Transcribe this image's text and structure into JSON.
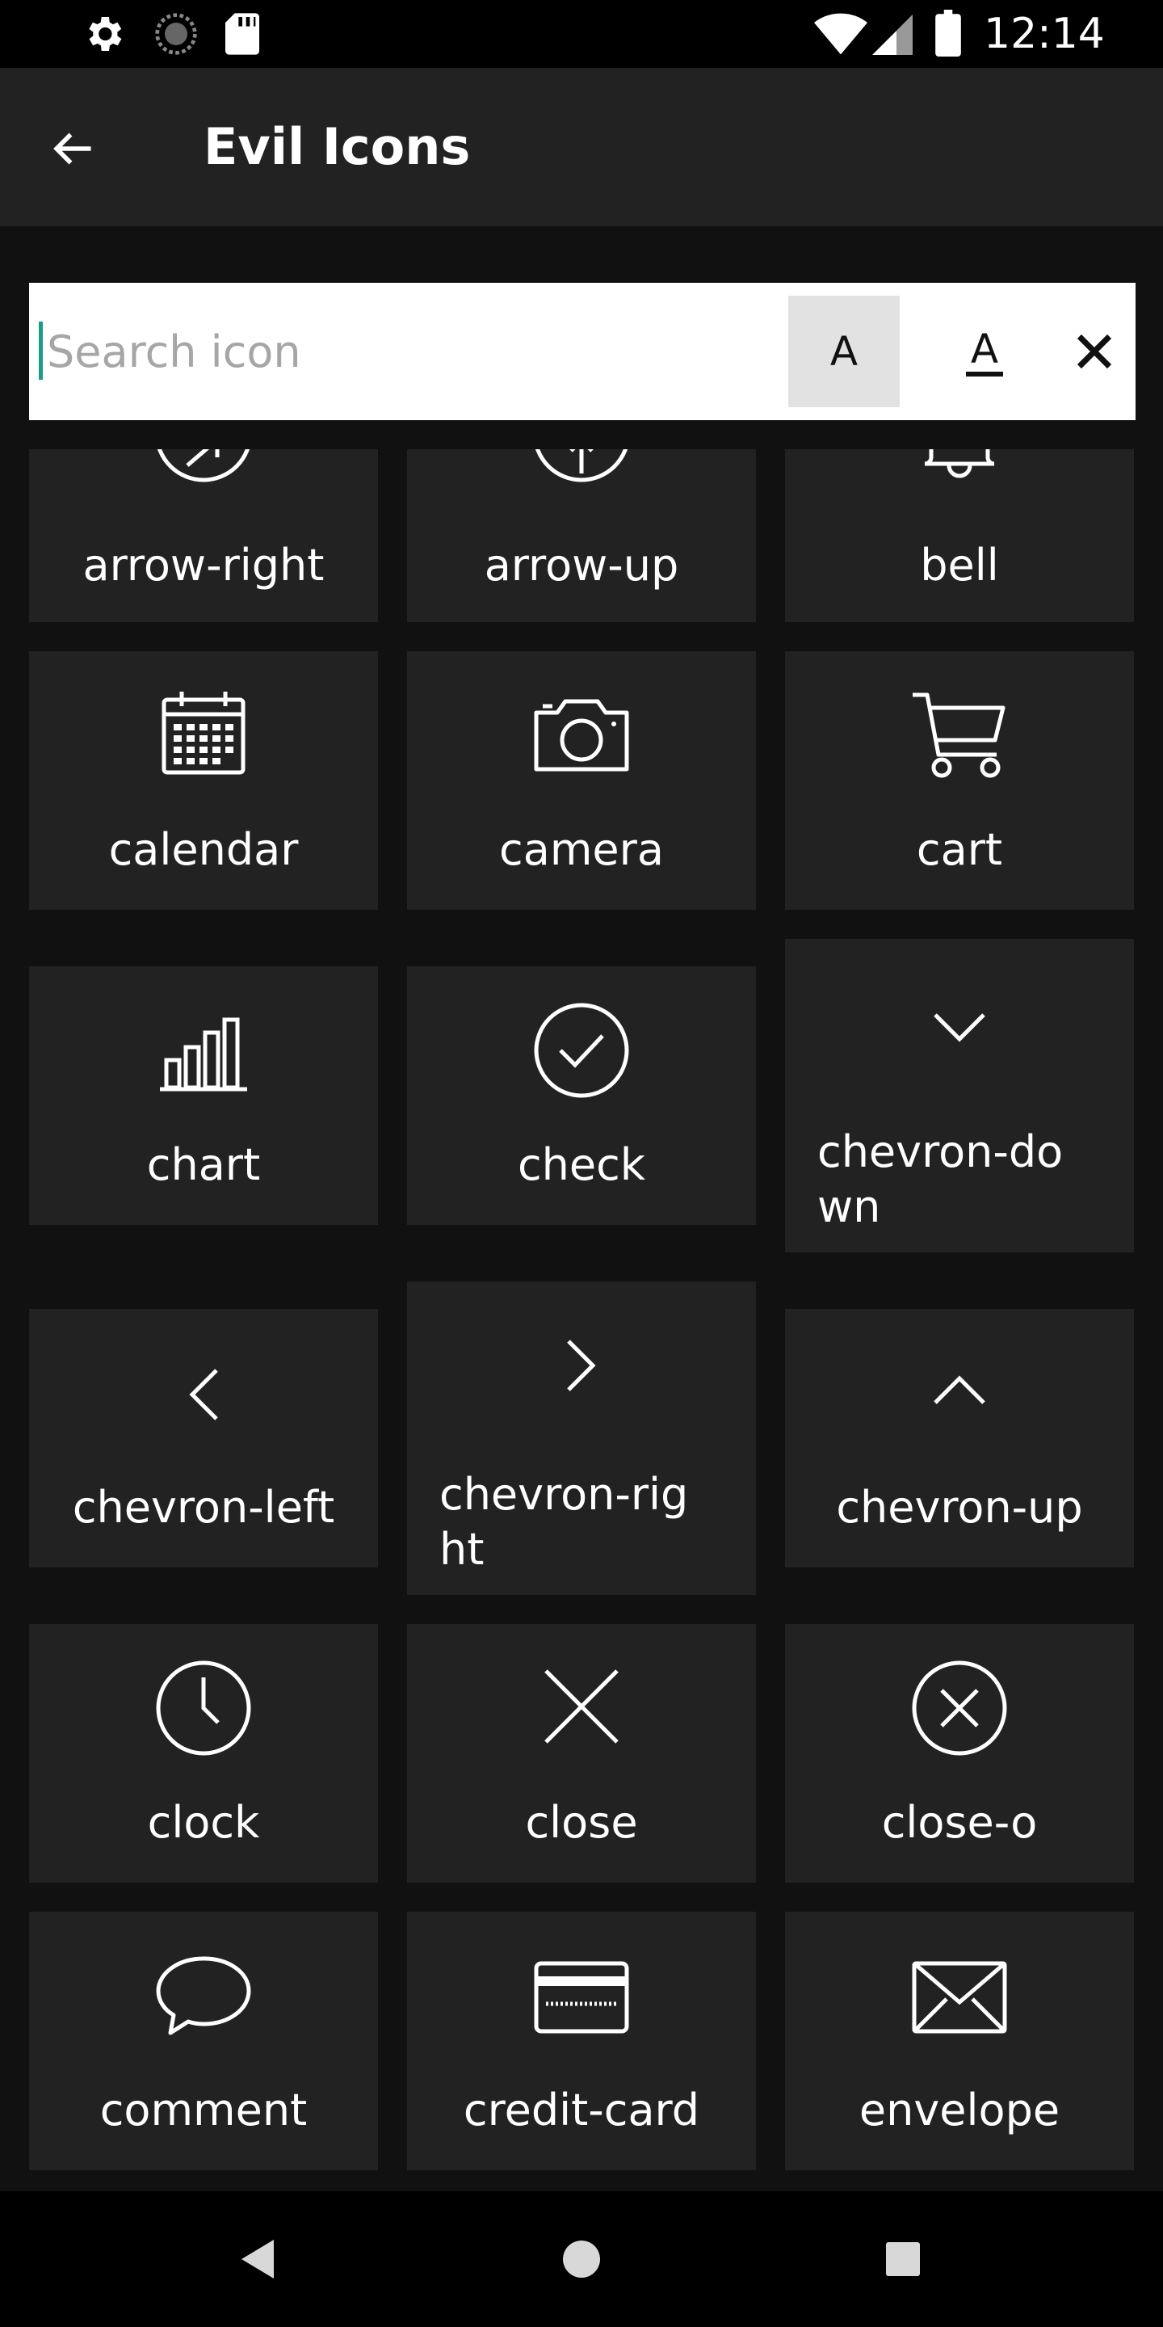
{
  "status_bar": {
    "time": "12:14",
    "left_icons": [
      "settings-icon",
      "sync-icon",
      "sd-card-icon"
    ],
    "right_icons": [
      "wifi-icon",
      "cellular-icon",
      "battery-icon"
    ]
  },
  "app_bar": {
    "title": "Evil Icons",
    "back_icon": "arrow-left-icon"
  },
  "search": {
    "placeholder": "Search icon",
    "value": "",
    "case_sensitive_label": "A",
    "whole_word_label": "A",
    "clear_icon": "close-icon"
  },
  "icons": [
    {
      "label": "arrow-right",
      "icon": "arrow-right-icon"
    },
    {
      "label": "arrow-up",
      "icon": "arrow-up-icon"
    },
    {
      "label": "bell",
      "icon": "bell-icon"
    },
    {
      "label": "calendar",
      "icon": "calendar-icon"
    },
    {
      "label": "camera",
      "icon": "camera-icon"
    },
    {
      "label": "cart",
      "icon": "cart-icon"
    },
    {
      "label": "chart",
      "icon": "chart-icon"
    },
    {
      "label": "check",
      "icon": "check-icon"
    },
    {
      "label": "chevron-do\nwn",
      "icon": "chevron-down-icon"
    },
    {
      "label": "chevron-left",
      "icon": "chevron-left-icon"
    },
    {
      "label": "chevron-rig\nht",
      "icon": "chevron-right-icon"
    },
    {
      "label": "chevron-up",
      "icon": "chevron-up-icon"
    },
    {
      "label": "clock",
      "icon": "clock-icon"
    },
    {
      "label": "close",
      "icon": "close-icon"
    },
    {
      "label": "close-o",
      "icon": "close-o-icon"
    },
    {
      "label": "comment",
      "icon": "comment-icon"
    },
    {
      "label": "credit-card",
      "icon": "credit-card-icon"
    },
    {
      "label": "envelope",
      "icon": "envelope-icon"
    }
  ],
  "nav_bar": {
    "back_icon": "nav-back-icon",
    "home_icon": "nav-home-icon",
    "recents_icon": "nav-recents-icon"
  },
  "colors": {
    "background": "#111111",
    "tile": "#222222",
    "app_bar": "#222222",
    "accent": "#1a9c8a"
  }
}
